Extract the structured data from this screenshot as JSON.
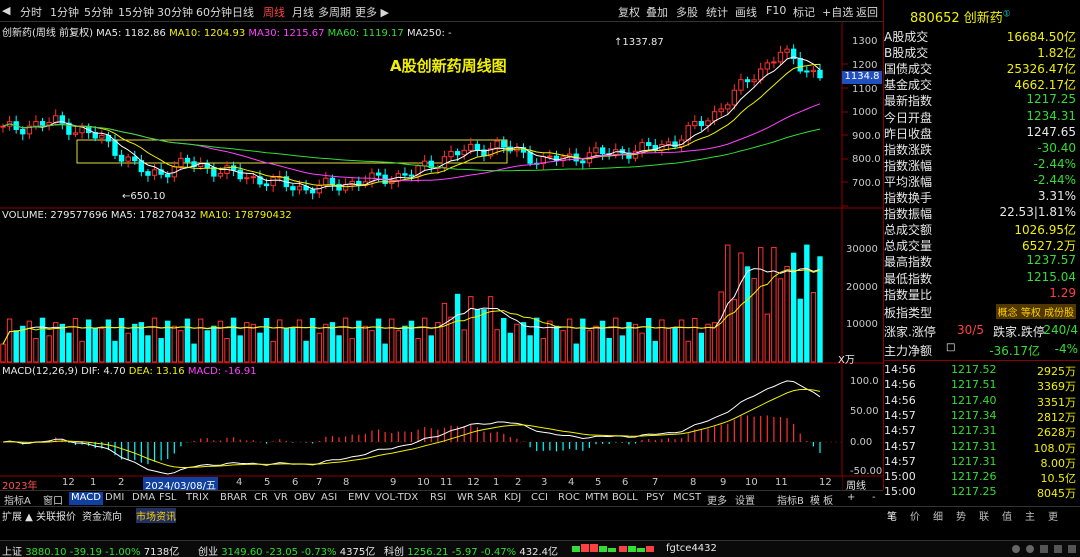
{
  "toolbar": {
    "periods": [
      "分时",
      "1分钟",
      "5分钟",
      "15分钟",
      "30分钟",
      "60分钟",
      "日线",
      "周线",
      "月线",
      "多周期",
      "更多 ▶"
    ],
    "active_period": "周线",
    "right": [
      "复权",
      "叠加",
      "多股",
      "统计",
      "画线",
      "F10",
      "标记",
      "+自选",
      "返回"
    ]
  },
  "stock": {
    "code": "880652",
    "name": "创新药",
    "icon": "①"
  },
  "chart": {
    "legend": {
      "title": "创新药(周线 前复权)",
      "ma5": "MA5: 1182.86",
      "ma10": "MA10: 1204.93",
      "ma30": "MA30: 1215.67",
      "ma60": "MA60: 1119.17",
      "ma250": "MA250: -"
    },
    "annotation": "A股创新药周线图",
    "high_label": "1337.87",
    "low_label": "650.10",
    "price_tag": "1134.8",
    "y_ticks": [
      "1300",
      "1200",
      "1100",
      "1000",
      "900.0",
      "800.0",
      "700.0"
    ],
    "volume_legend": {
      "volume": "VOLUME: 279577696",
      "ma5": "MA5: 178270432",
      "ma10": "MA10: 178790432"
    },
    "volume_ticks": [
      "30000",
      "20000",
      "10000"
    ],
    "volume_unit": "X万",
    "macd_legend": {
      "macd": "MACD(12,26,9)",
      "dif": "DIF: 4.70",
      "dea": "DEA: 13.16",
      "macd_val": "MACD: -16.91"
    },
    "macd_ticks": [
      "100.0",
      "50.00",
      "0.00",
      "-50.00"
    ],
    "x_labels": [
      "2023年",
      "12",
      "1",
      "2",
      "3",
      "4",
      "5",
      "6",
      "7",
      "8",
      "9",
      "10",
      "11",
      "12",
      "1",
      "2",
      "3",
      "4",
      "5",
      "6",
      "7",
      "8",
      "9",
      "10",
      "11",
      "12",
      "1",
      "2",
      "3",
      "4"
    ],
    "cursor_date": "2024/03/08/五",
    "period_btn": "周线"
  },
  "chart_data": {
    "type": "candlestick",
    "title": "A股创新药周线图",
    "series": [
      "K线",
      "MA5",
      "MA10",
      "MA30",
      "MA60",
      "VOLUME",
      "MACD"
    ],
    "y_range": [
      620,
      1380
    ],
    "high": 1337.87,
    "low": 650.1,
    "macd_range": [
      -60,
      110
    ]
  },
  "indicators": [
    "指标A",
    "窗口",
    "MACD",
    "DMI",
    "DMA",
    "FSL",
    "TRIX",
    "BRAR",
    "CR",
    "VR",
    "OBV",
    "ASI",
    "EMV",
    "VOL-TDX",
    "RSI",
    "WR",
    "SAR",
    "KDJ",
    "CCI",
    "ROC",
    "MTM",
    "BOLL",
    "PSY",
    "MCST",
    "更多",
    "设置"
  ],
  "active_indicator": "MACD",
  "indicator_right": [
    "指标B",
    "模 板",
    "+",
    "-"
  ],
  "panel": {
    "rows": [
      {
        "k": "A股成交",
        "v": "16684.50亿",
        "c": "yel"
      },
      {
        "k": "B股成交",
        "v": "1.82亿",
        "c": "yel"
      },
      {
        "k": "国债成交",
        "v": "25326.47亿",
        "c": "yel"
      },
      {
        "k": "基金成交",
        "v": "4662.17亿",
        "c": "yel"
      },
      {
        "k": "最新指数",
        "v": "1217.25",
        "c": "grn"
      },
      {
        "k": "今日开盘",
        "v": "1234.31",
        "c": "grn"
      },
      {
        "k": "昨日收盘",
        "v": "1247.65",
        "c": "wht"
      },
      {
        "k": "指数涨跌",
        "v": "-30.40",
        "c": "grn"
      },
      {
        "k": "指数涨幅",
        "v": "-2.44%",
        "c": "grn"
      },
      {
        "k": "平均涨幅",
        "v": "-2.44%",
        "c": "grn"
      },
      {
        "k": "指数换手",
        "v": "3.31%",
        "c": "wht"
      },
      {
        "k": "指数振幅",
        "v": "22.53|1.81%",
        "c": "wht"
      },
      {
        "k": "总成交额",
        "v": "1026.95亿",
        "c": "yel"
      },
      {
        "k": "总成交量",
        "v": "6527.2万",
        "c": "yel"
      },
      {
        "k": "最高指数",
        "v": "1237.57",
        "c": "grn"
      },
      {
        "k": "最低指数",
        "v": "1215.04",
        "c": "grn"
      },
      {
        "k": "指数量比",
        "v": "1.29",
        "c": "red"
      }
    ],
    "board_type": {
      "k": "板指类型",
      "v": "概念 等权 成份股"
    },
    "updown": {
      "k": "涨家.涨停",
      "v1": "30/5",
      "k2": "跌家.跌停",
      "v2": "240/4"
    },
    "mainflow": {
      "k": "主力净额",
      "v": "-36.17亿",
      "pct": "-4%"
    },
    "ticks": [
      {
        "t": "14:56",
        "p": "1217.52",
        "v": "2925万"
      },
      {
        "t": "14:56",
        "p": "1217.51",
        "v": "3369万"
      },
      {
        "t": "14:56",
        "p": "1217.40",
        "v": "3351万"
      },
      {
        "t": "14:57",
        "p": "1217.34",
        "v": "2812万"
      },
      {
        "t": "14:57",
        "p": "1217.31",
        "v": "2628万"
      },
      {
        "t": "14:57",
        "p": "1217.31",
        "v": "108.0万"
      },
      {
        "t": "14:57",
        "p": "1217.31",
        "v": "8.00万"
      },
      {
        "t": "15:00",
        "p": "1217.26",
        "v": "10.5亿"
      },
      {
        "t": "15:00",
        "p": "1217.25",
        "v": "8045万"
      }
    ],
    "tabs": [
      "笔",
      "价",
      "细",
      "势",
      "联",
      "值",
      "主",
      "更"
    ]
  },
  "bottom_tabs": [
    "扩展 ▲",
    "关联报价",
    "资金流向",
    "市场资讯"
  ],
  "status": {
    "sh": {
      "n": "上证",
      "p": "3880.10",
      "c": "-39.19",
      "pct": "-1.00%",
      "a": "7138亿"
    },
    "cy": {
      "n": "创业",
      "p": "3149.60",
      "c": "-23.05",
      "pct": "-0.73%",
      "a": "4375亿"
    },
    "kc": {
      "n": "科创",
      "p": "1256.21",
      "c": "-5.97",
      "pct": "-0.47%",
      "a": "432.4亿"
    },
    "user": "fgtce4432"
  }
}
